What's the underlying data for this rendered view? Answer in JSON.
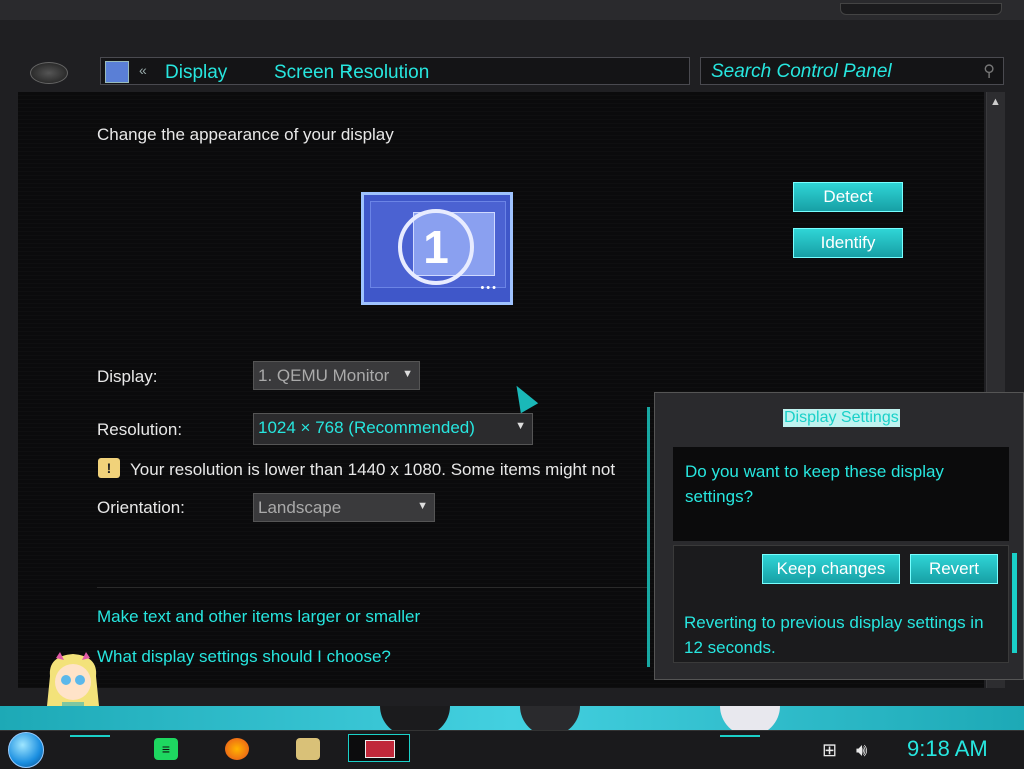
{
  "address_bar": {
    "back_chevron": "«",
    "crumbs": [
      "Display",
      "Screen Resolution"
    ],
    "separator": "•",
    "dropdown_glyph": "⌄",
    "refresh_glyph": "↻"
  },
  "search": {
    "placeholder": "Search Control Panel",
    "icon": "magnifier-icon"
  },
  "main": {
    "heading": "Change the appearance of your display",
    "monitor_number": "1",
    "monitor_dots": "•••",
    "detect_label": "Detect",
    "identify_label": "Identify",
    "display_label": "Display:",
    "display_value": "1. QEMU Monitor",
    "resolution_label": "Resolution:",
    "resolution_value": "1024 × 768 (Recommended)",
    "warning_text": "Your resolution is lower than 1440 x 1080. Some items might not",
    "orientation_label": "Orientation:",
    "orientation_value": "Landscape",
    "links": [
      "Make text and other items larger or smaller",
      "What display settings should I choose?"
    ]
  },
  "dialog": {
    "title": "Display Settings",
    "question": "Do you want to keep these display settings?",
    "keep_label": "Keep changes",
    "revert_label": "Revert",
    "countdown": "Reverting to previous display settings in 12 seconds."
  },
  "taskbar": {
    "clock": "9:18 AM"
  },
  "colors": {
    "accent": "#27e6df",
    "button": "#1fb9bd",
    "background": "#0b0b0c"
  }
}
